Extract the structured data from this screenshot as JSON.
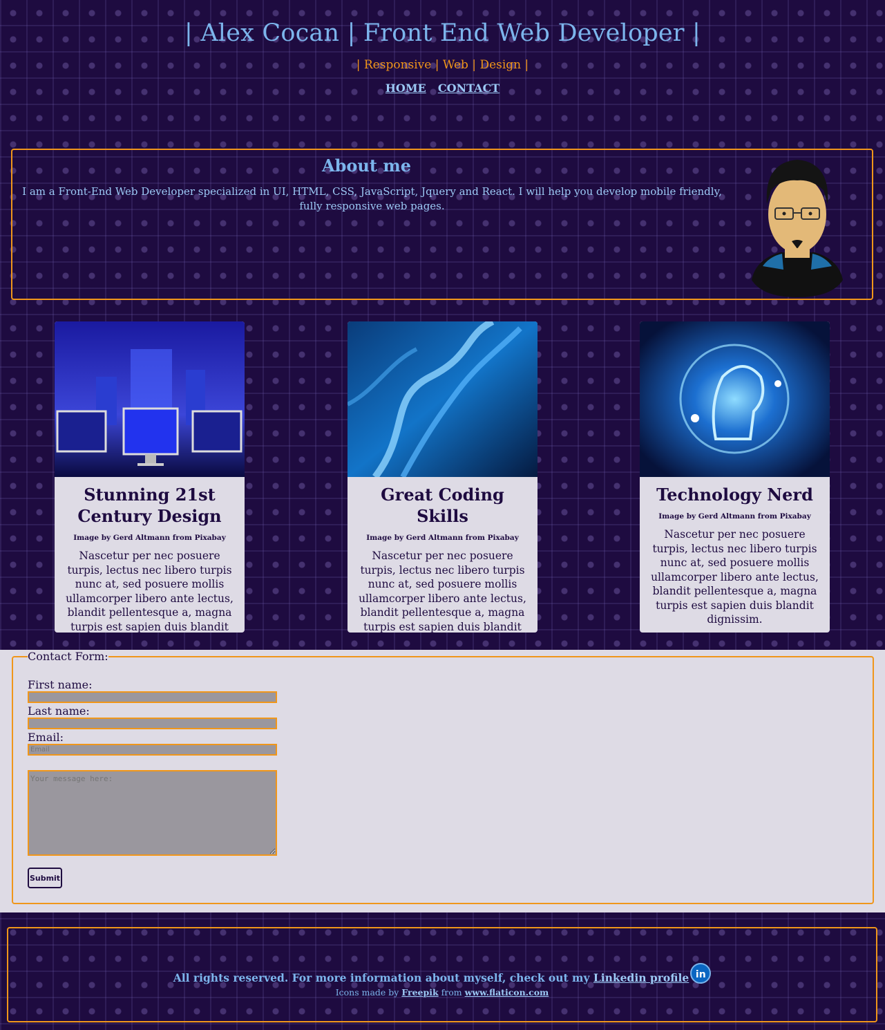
{
  "header": {
    "title": "| Alex Cocan | Front End Web Developer |",
    "subtitle": "| Responsive | Web | Design |",
    "nav": [
      "HOME",
      "CONTACT"
    ]
  },
  "about": {
    "heading": "About me",
    "text": "I am a Front-End Web Developer specialized in UI, HTML, CSS, JavaScript, Jquery and React. I will help you develop mobile friendly, fully responsive web pages."
  },
  "cards": [
    {
      "title": "Stunning 21st Century Design",
      "credit": "Image by Gerd Altmann from Pixabay",
      "text": "Nascetur per nec posuere turpis, lectus nec libero turpis nunc at, sed posuere mollis ullamcorper libero ante lectus, blandit pellentesque a, magna turpis est sapien duis blandit dignissim."
    },
    {
      "title": "Great Coding Skills",
      "credit": "Image by Gerd Altmann from Pixabay",
      "text": "Nascetur per nec posuere turpis, lectus nec libero turpis nunc at, sed posuere mollis ullamcorper libero ante lectus, blandit pellentesque a, magna turpis est sapien duis blandit dignissim."
    },
    {
      "title": "Technology Nerd",
      "credit": "Image by Gerd Altmann from Pixabay",
      "text": "Nascetur per nec posuere turpis, lectus nec libero turpis nunc at, sed posuere mollis ullamcorper libero ante lectus, blandit pellentesque a, magna turpis est sapien duis blandit dignissim."
    }
  ],
  "form": {
    "legend": "Contact Form:",
    "first_name_label": "First name:",
    "last_name_label": "Last name:",
    "email_label": "Email:",
    "email_placeholder": "Email",
    "message_placeholder": "Your message here:",
    "submit_label": "Submit"
  },
  "footer": {
    "text": "All rights reserved. For more information about myself, check out my",
    "link": "Linkedin profile",
    "linkedin_icon": "in",
    "icons_prefix": "Icons made by",
    "icons_author": "Freepik",
    "icons_from": "from",
    "icons_site": "www.flaticon.com"
  },
  "colors": {
    "background": "#1e0b40",
    "accent_orange": "#f0961a",
    "accent_blue": "#7cb5ec",
    "card_bg": "#dedbe5"
  }
}
